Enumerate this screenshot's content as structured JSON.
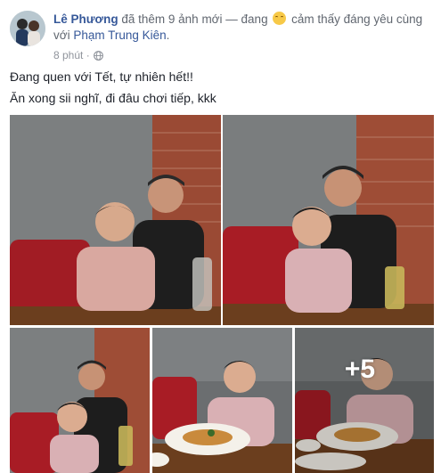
{
  "post": {
    "author": "Lê Phương",
    "action": " đã thêm 9 ảnh mới — đang ",
    "feeling": " cảm thấy đáng yêu cùng với ",
    "tagged_user": "Phạm Trung Kiên",
    "period": ".",
    "timestamp": "8 phút · ",
    "privacy_icon": "globe-icon",
    "feeling_icon": "smiling-face-icon",
    "lines": [
      "Đang quen với Tết, tự nhiên hết!!",
      "Ăn xong sii nghĩ, đi đâu chơi tiếp, kkk"
    ],
    "more_photos_label": "+5"
  },
  "colors": {
    "link": "#365899",
    "meta": "#90949c",
    "text": "#1d2129"
  }
}
